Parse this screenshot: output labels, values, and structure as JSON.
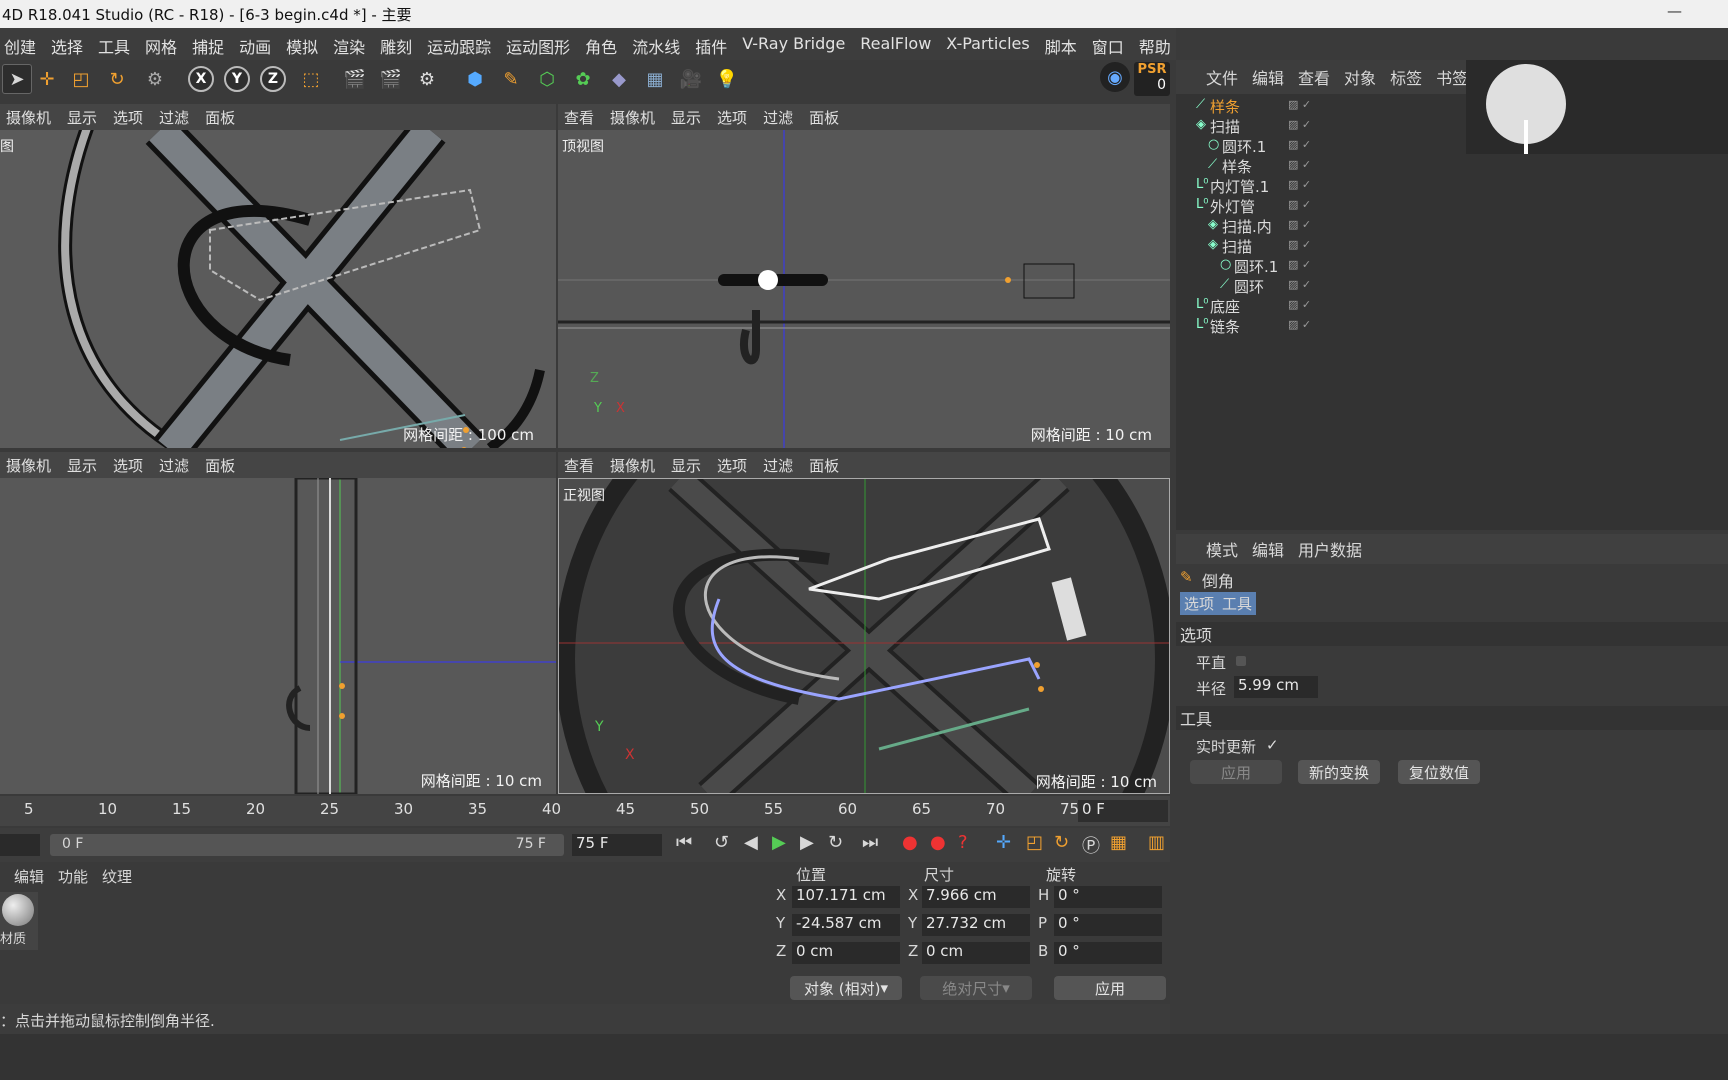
{
  "title": "4D R18.041 Studio (RC - R18) - [6-3 begin.c4d *] - 主要",
  "menu": [
    "创建",
    "选择",
    "工具",
    "网格",
    "捕捉",
    "动画",
    "模拟",
    "渲染",
    "雕刻",
    "运动跟踪",
    "运动图形",
    "角色",
    "流水线",
    "插件",
    "V-Ray Bridge",
    "RealFlow",
    "X-Particles",
    "脚本",
    "窗口",
    "帮助"
  ],
  "psr": {
    "label": "PSR",
    "value": "0"
  },
  "axes": [
    "X",
    "Y",
    "Z"
  ],
  "vp_tl": {
    "menu": [
      "摄像机",
      "显示",
      "选项",
      "过滤",
      "面板"
    ],
    "label": "图",
    "grid": "网格间距 : 100 cm"
  },
  "vp_tr": {
    "menu": [
      "查看",
      "摄像机",
      "显示",
      "选项",
      "过滤",
      "面板"
    ],
    "label": "顶视图",
    "grid": "网格间距 : 10 cm"
  },
  "vp_bl": {
    "menu": [
      "摄像机",
      "显示",
      "选项",
      "过滤",
      "面板"
    ],
    "grid": "网格间距 : 10 cm"
  },
  "vp_br": {
    "menu": [
      "查看",
      "摄像机",
      "显示",
      "选项",
      "过滤",
      "面板"
    ],
    "label": "正视图",
    "grid": "网格间距 : 10 cm"
  },
  "objmgr": {
    "menu": [
      "文件",
      "编辑",
      "查看",
      "对象",
      "标签",
      "书签"
    ],
    "rows": [
      {
        "name": "样条",
        "icon": "spline-icon",
        "indent": 0,
        "selected": true
      },
      {
        "name": "扫描",
        "icon": "sweep-icon",
        "indent": 0
      },
      {
        "name": "圆环.1",
        "icon": "circle-icon",
        "indent": 1
      },
      {
        "name": "样条",
        "icon": "spline-icon",
        "indent": 1
      },
      {
        "name": "内灯管.1",
        "icon": "null-icon",
        "indent": 0
      },
      {
        "name": "外灯管",
        "icon": "null-icon",
        "indent": 0
      },
      {
        "name": "扫描.内",
        "icon": "sweep-icon",
        "indent": 1
      },
      {
        "name": "扫描",
        "icon": "sweep-icon",
        "indent": 1
      },
      {
        "name": "圆环.1",
        "icon": "circle-icon",
        "indent": 2
      },
      {
        "name": "圆环",
        "icon": "spline-icon",
        "indent": 2
      },
      {
        "name": "底座",
        "icon": "null-icon",
        "indent": 0
      },
      {
        "name": "链条",
        "icon": "null-icon",
        "indent": 0
      }
    ]
  },
  "attr": {
    "menu": [
      "模式",
      "编辑",
      "用户数据"
    ],
    "tool": "倒角",
    "tabs": [
      "选项",
      "工具"
    ],
    "sect_options": "选项",
    "flat_label": "平直",
    "radius_label": "半径",
    "radius_value": "5.99 cm",
    "sect_tool": "工具",
    "realtime_label": "实时更新",
    "apply": "应用",
    "new_transform": "新的变换",
    "reset": "复位数值"
  },
  "timeline": {
    "ticks": [
      "5",
      "10",
      "15",
      "20",
      "25",
      "30",
      "35",
      "40",
      "45",
      "50",
      "55",
      "60",
      "65",
      "70",
      "75"
    ],
    "current": "0 F"
  },
  "playbar": {
    "start": "0 F",
    "end": "75 F",
    "max": "75 F"
  },
  "matmgr": {
    "menu": [
      "编辑",
      "功能",
      "纹理"
    ],
    "material": "材质"
  },
  "coord": {
    "headers": [
      "位置",
      "尺寸",
      "旋转"
    ],
    "rows": [
      {
        "axis": "X",
        "pos": "107.171 cm",
        "size_axis": "X",
        "size": "7.966 cm",
        "rot_axis": "H",
        "rot": "0 °"
      },
      {
        "axis": "Y",
        "pos": "-24.587 cm",
        "size_axis": "Y",
        "size": "27.732 cm",
        "rot_axis": "P",
        "rot": "0 °"
      },
      {
        "axis": "Z",
        "pos": "0 cm",
        "size_axis": "Z",
        "size": "0 cm",
        "rot_axis": "B",
        "rot": "0 °"
      }
    ],
    "mode": "对象 (相对)",
    "size_mode": "绝对尺寸",
    "apply": "应用"
  },
  "status": "：点击并拖动鼠标控制倒角半径."
}
